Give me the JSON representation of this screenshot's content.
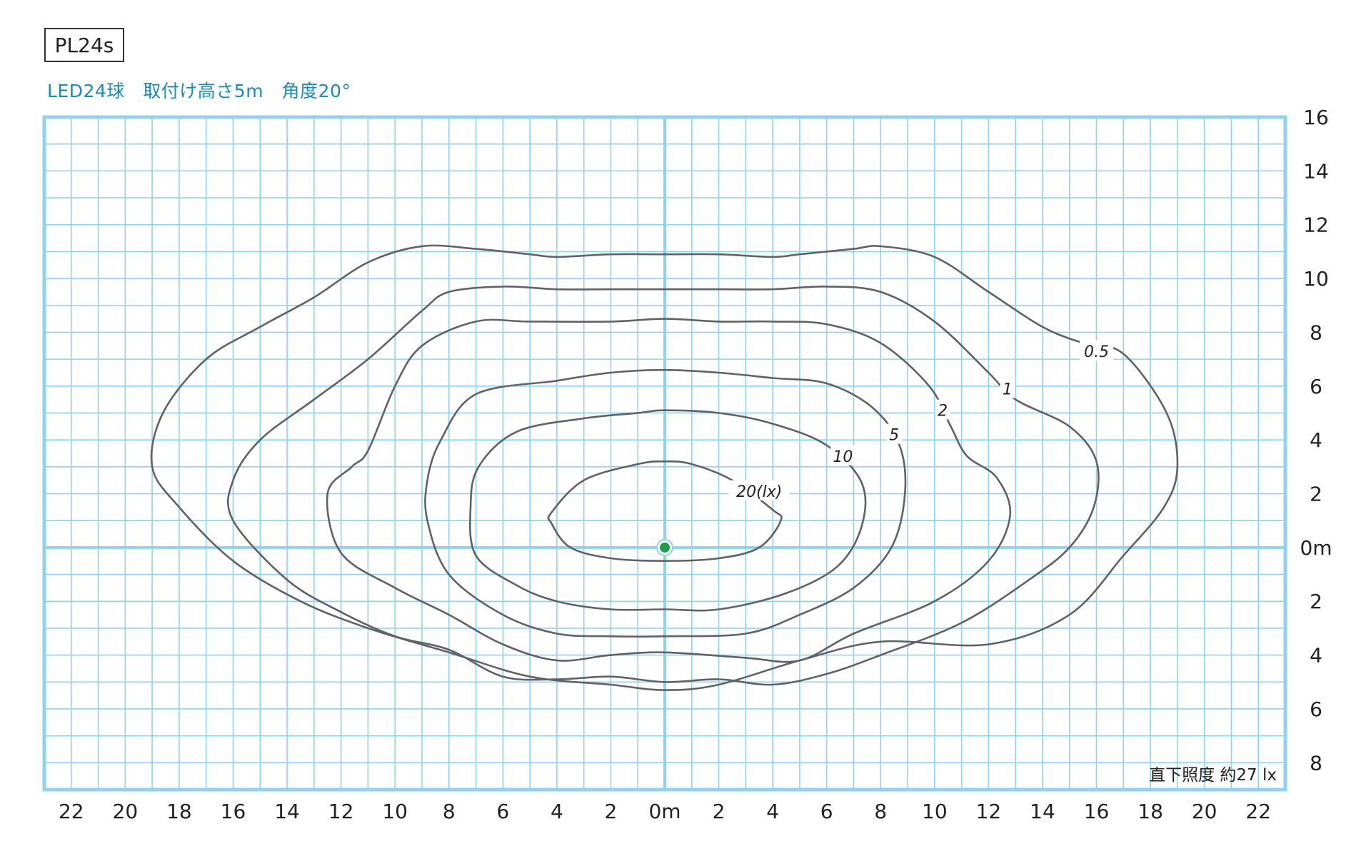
{
  "header": {
    "model": "PL24s",
    "subtitle": "LED24球　取付け高さ5m　角度20°"
  },
  "chart_data": {
    "type": "contour",
    "title": "",
    "xlabel": "",
    "ylabel": "",
    "xlim": [
      -23,
      23
    ],
    "ylim": [
      -9,
      16
    ],
    "grid": true,
    "x_ticks": [
      {
        "v": -22,
        "label": "22"
      },
      {
        "v": -20,
        "label": "20"
      },
      {
        "v": -18,
        "label": "18"
      },
      {
        "v": -16,
        "label": "16"
      },
      {
        "v": -14,
        "label": "14"
      },
      {
        "v": -12,
        "label": "12"
      },
      {
        "v": -10,
        "label": "10"
      },
      {
        "v": -8,
        "label": "8"
      },
      {
        "v": -6,
        "label": "6"
      },
      {
        "v": -4,
        "label": "4"
      },
      {
        "v": -2,
        "label": "2"
      },
      {
        "v": 0,
        "label": "0m"
      },
      {
        "v": 2,
        "label": "2"
      },
      {
        "v": 4,
        "label": "4"
      },
      {
        "v": 6,
        "label": "6"
      },
      {
        "v": 8,
        "label": "8"
      },
      {
        "v": 10,
        "label": "10"
      },
      {
        "v": 12,
        "label": "12"
      },
      {
        "v": 14,
        "label": "14"
      },
      {
        "v": 16,
        "label": "16"
      },
      {
        "v": 18,
        "label": "18"
      },
      {
        "v": 20,
        "label": "20"
      },
      {
        "v": 22,
        "label": "22"
      }
    ],
    "y_ticks": [
      {
        "v": 16,
        "label": "16"
      },
      {
        "v": 14,
        "label": "14"
      },
      {
        "v": 12,
        "label": "12"
      },
      {
        "v": 10,
        "label": "10"
      },
      {
        "v": 8,
        "label": "8"
      },
      {
        "v": 6,
        "label": "6"
      },
      {
        "v": 4,
        "label": "4"
      },
      {
        "v": 2,
        "label": "2"
      },
      {
        "v": 0,
        "label": "0m"
      },
      {
        "v": -2,
        "label": "2"
      },
      {
        "v": -4,
        "label": "4"
      },
      {
        "v": -6,
        "label": "6"
      },
      {
        "v": -8,
        "label": "8"
      }
    ],
    "source_point": {
      "x": 0,
      "y": 0,
      "color": "#1aa04a"
    },
    "note": "直下照度  約27 lx",
    "colors": {
      "grid": "#8fd3f0",
      "frame": "#8fd3f0",
      "axis": "#8fd3f0",
      "contour": "#5f6266"
    },
    "contours": [
      {
        "level": "0.5",
        "label": "0.5",
        "label_at": [
          16,
          7.3
        ],
        "points": [
          [
            -19,
            3
          ],
          [
            -18.6,
            5
          ],
          [
            -17,
            7
          ],
          [
            -15,
            8.2
          ],
          [
            -13,
            9.3
          ],
          [
            -11,
            10.6
          ],
          [
            -9,
            11.2
          ],
          [
            -7,
            11.1
          ],
          [
            -5,
            10.9
          ],
          [
            -4,
            10.8
          ],
          [
            -2,
            10.9
          ],
          [
            0,
            10.9
          ],
          [
            2,
            10.9
          ],
          [
            4,
            10.8
          ],
          [
            5,
            10.9
          ],
          [
            7,
            11.1
          ],
          [
            8,
            11.2
          ],
          [
            10,
            10.8
          ],
          [
            12,
            9.5
          ],
          [
            14,
            8.2
          ],
          [
            15.5,
            7.6
          ],
          [
            17,
            7.2
          ],
          [
            18.6,
            5
          ],
          [
            19,
            3
          ],
          [
            18.5,
            1.5
          ],
          [
            17,
            -0.3
          ],
          [
            15,
            -2.5
          ],
          [
            12,
            -3.6
          ],
          [
            8,
            -3.5
          ],
          [
            5,
            -4.2
          ],
          [
            2,
            -5.1
          ],
          [
            0,
            -5.3
          ],
          [
            -2,
            -5.1
          ],
          [
            -5,
            -4.8
          ],
          [
            -8,
            -3.9
          ],
          [
            -11,
            -3
          ],
          [
            -13.5,
            -2
          ],
          [
            -16,
            -0.5
          ],
          [
            -18,
            1.5
          ]
        ]
      },
      {
        "level": "1",
        "label": "1",
        "label_at": [
          12.7,
          5.9
        ],
        "points": [
          [
            -16,
            2.5
          ],
          [
            -15,
            4
          ],
          [
            -13,
            5.5
          ],
          [
            -11,
            7
          ],
          [
            -9,
            8.8
          ],
          [
            -8,
            9.5
          ],
          [
            -6,
            9.7
          ],
          [
            -4,
            9.6
          ],
          [
            -2,
            9.6
          ],
          [
            0,
            9.6
          ],
          [
            2,
            9.6
          ],
          [
            4,
            9.6
          ],
          [
            6,
            9.7
          ],
          [
            8,
            9.5
          ],
          [
            10,
            8.4
          ],
          [
            12,
            6.5
          ],
          [
            13,
            5.5
          ],
          [
            15,
            4.5
          ],
          [
            16,
            3.2
          ],
          [
            15.9,
            1.5
          ],
          [
            15,
            0
          ],
          [
            13.5,
            -1.2
          ],
          [
            11,
            -2.8
          ],
          [
            8,
            -4
          ],
          [
            6,
            -4.7
          ],
          [
            4,
            -5.1
          ],
          [
            2,
            -4.9
          ],
          [
            0,
            -5
          ],
          [
            -2,
            -4.8
          ],
          [
            -4,
            -4.9
          ],
          [
            -6,
            -4.8
          ],
          [
            -8,
            -3.8
          ],
          [
            -10,
            -3.3
          ],
          [
            -12,
            -2.4
          ],
          [
            -14,
            -1.2
          ],
          [
            -16,
            1
          ]
        ]
      },
      {
        "level": "2",
        "label": "2",
        "label_at": [
          10.3,
          5.1
        ],
        "points": [
          [
            -12.5,
            2
          ],
          [
            -11.6,
            3
          ],
          [
            -11,
            3.6
          ],
          [
            -10,
            6
          ],
          [
            -9,
            7.5
          ],
          [
            -7,
            8.4
          ],
          [
            -5,
            8.4
          ],
          [
            -2,
            8.4
          ],
          [
            0,
            8.5
          ],
          [
            2,
            8.4
          ],
          [
            4,
            8.4
          ],
          [
            6,
            8.3
          ],
          [
            8,
            7.6
          ],
          [
            9.8,
            6
          ],
          [
            10.6,
            4.5
          ],
          [
            11.2,
            3.4
          ],
          [
            12.3,
            2.6
          ],
          [
            12.8,
            1.2
          ],
          [
            12,
            -0.5
          ],
          [
            10,
            -2
          ],
          [
            7,
            -3.2
          ],
          [
            5,
            -4.2
          ],
          [
            3,
            -4.1
          ],
          [
            0,
            -3.9
          ],
          [
            -2,
            -4
          ],
          [
            -4,
            -4.2
          ],
          [
            -6,
            -3.6
          ],
          [
            -8,
            -2.5
          ],
          [
            -10,
            -1.5
          ],
          [
            -12,
            -0.2
          ]
        ]
      },
      {
        "level": "5",
        "label": "5",
        "label_at": [
          8.5,
          4.2
        ],
        "points": [
          [
            -8.8,
            2.5
          ],
          [
            -8.3,
            4
          ],
          [
            -7,
            5.7
          ],
          [
            -4,
            6.2
          ],
          [
            -2,
            6.5
          ],
          [
            0,
            6.6
          ],
          [
            2,
            6.5
          ],
          [
            4,
            6.3
          ],
          [
            6,
            6.1
          ],
          [
            7.7,
            5.2
          ],
          [
            8.7,
            3.8
          ],
          [
            8.9,
            2
          ],
          [
            8.4,
            0
          ],
          [
            7,
            -1.5
          ],
          [
            5,
            -2.5
          ],
          [
            3,
            -3.2
          ],
          [
            0,
            -3.3
          ],
          [
            -2,
            -3.3
          ],
          [
            -4,
            -3.2
          ],
          [
            -6,
            -2.5
          ],
          [
            -8,
            -1
          ],
          [
            -8.8,
            1
          ]
        ]
      },
      {
        "level": "10",
        "label": "10",
        "label_at": [
          6.6,
          3.4
        ],
        "points": [
          [
            -7.2,
            1.5
          ],
          [
            -6.9,
            3
          ],
          [
            -5.5,
            4.3
          ],
          [
            -3,
            4.8
          ],
          [
            -1,
            5
          ],
          [
            0,
            5.1
          ],
          [
            2,
            5
          ],
          [
            4,
            4.6
          ],
          [
            6,
            3.8
          ],
          [
            7.3,
            2.4
          ],
          [
            7.3,
            0.8
          ],
          [
            6.4,
            -0.7
          ],
          [
            4.5,
            -1.7
          ],
          [
            2,
            -2.3
          ],
          [
            0,
            -2.3
          ],
          [
            -2,
            -2.3
          ],
          [
            -4,
            -2
          ],
          [
            -5.5,
            -1.4
          ],
          [
            -7,
            -0.3
          ]
        ]
      },
      {
        "level": "20",
        "label": "20(lx)",
        "label_at": [
          3.5,
          2.1
        ],
        "points": [
          [
            -4.2,
            1.3
          ],
          [
            -3,
            2.5
          ],
          [
            -1,
            3.1
          ],
          [
            0,
            3.2
          ],
          [
            1,
            3.1
          ],
          [
            2.5,
            2.5
          ],
          [
            4,
            1.4
          ],
          [
            4.3,
            1
          ],
          [
            3.5,
            0
          ],
          [
            2,
            -0.4
          ],
          [
            0,
            -0.5
          ],
          [
            -2,
            -0.4
          ],
          [
            -3.5,
            0
          ],
          [
            -4.2,
            0.9
          ]
        ]
      }
    ]
  }
}
